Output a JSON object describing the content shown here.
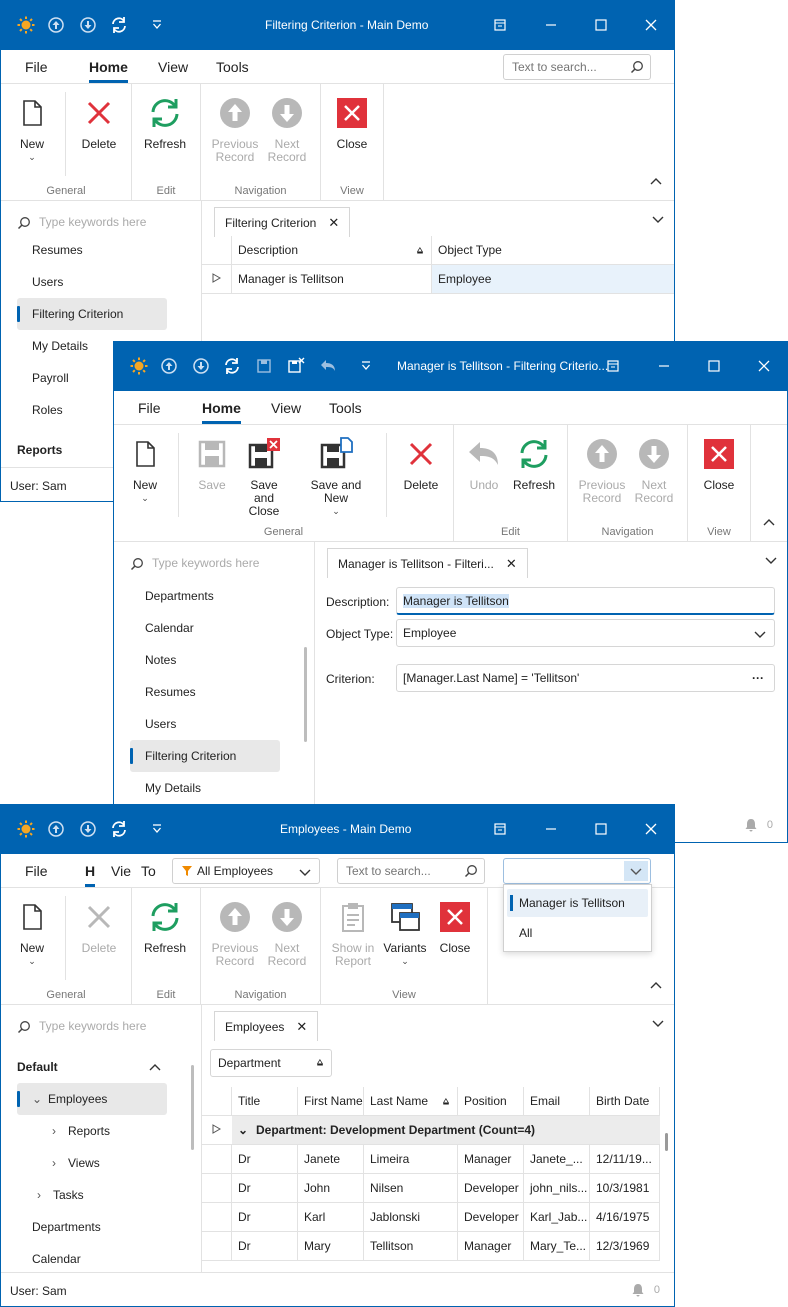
{
  "win1": {
    "title": "Filtering Criterion - Main Demo",
    "menu": {
      "file": "File",
      "home": "Home",
      "view": "View",
      "tools": "Tools"
    },
    "search_placeholder": "Text to search...",
    "ribbon": {
      "new": "New",
      "delete": "Delete",
      "refresh": "Refresh",
      "previous": "Previous Record",
      "next": "Next Record",
      "close": "Close",
      "groups": {
        "general": "General",
        "edit": "Edit",
        "navigation": "Navigation",
        "view": "View"
      }
    },
    "nav": {
      "search_placeholder": "Type keywords here",
      "items": [
        "Resumes",
        "Users",
        "Filtering Criterion",
        "My Details",
        "Payroll",
        "Roles"
      ],
      "reports": "Reports"
    },
    "tab": "Filtering Criterion",
    "grid": {
      "headers": [
        "Description",
        "Object Type"
      ],
      "rows": [
        [
          "Manager is Tellitson",
          "Employee"
        ]
      ]
    },
    "status_user": "User: Sam"
  },
  "win2": {
    "title": "Manager is Tellitson - Filtering Criterio...",
    "menu": {
      "file": "File",
      "home": "Home",
      "view": "View",
      "tools": "Tools"
    },
    "ribbon": {
      "new": "New",
      "save": "Save",
      "save_close": "Save and Close",
      "save_new": "Save and New",
      "delete": "Delete",
      "undo": "Undo",
      "refresh": "Refresh",
      "previous": "Previous Record",
      "next": "Next Record",
      "close": "Close",
      "groups": {
        "general": "General",
        "edit": "Edit",
        "navigation": "Navigation",
        "view": "View"
      }
    },
    "nav": {
      "search_placeholder": "Type keywords here",
      "items": [
        "Departments",
        "Calendar",
        "Notes",
        "Resumes",
        "Users",
        "Filtering Criterion",
        "My Details"
      ]
    },
    "tab": "Manager is Tellitson - Filteri...",
    "form": {
      "description_label": "Description:",
      "description_value": "Manager is Tellitson",
      "object_type_label": "Object Type:",
      "object_type_value": "Employee",
      "criterion_label": "Criterion:",
      "criterion_value": "[Manager.Last Name] = 'Tellitson'"
    },
    "bell_count": "0"
  },
  "win3": {
    "title": "Employees - Main Demo",
    "menu": {
      "file": "File",
      "home": "H",
      "view": "Vie",
      "tools": "To"
    },
    "filter_combo": "All Employees",
    "search_placeholder": "Text to search...",
    "dropdown_options": [
      "Manager is Tellitson",
      "All"
    ],
    "ribbon": {
      "new": "New",
      "delete": "Delete",
      "refresh": "Refresh",
      "previous": "Previous Record",
      "next": "Next Record",
      "show_report": "Show in Report",
      "variants": "Variants",
      "close": "Close",
      "groups": {
        "general": "General",
        "edit": "Edit",
        "navigation": "Navigation",
        "view": "View"
      }
    },
    "nav": {
      "search_placeholder": "Type keywords here",
      "default": "Default",
      "employees": "Employees",
      "reports": "Reports",
      "views": "Views",
      "tasks": "Tasks",
      "departments": "Departments",
      "calendar": "Calendar"
    },
    "tab": "Employees",
    "group_panel": "Department",
    "grid": {
      "headers": [
        "Title",
        "First Name",
        "Last Name",
        "Position",
        "Email",
        "Birth Date"
      ],
      "group_row": "Department: Development Department (Count=4)",
      "rows": [
        [
          "Dr",
          "Janete",
          "Limeira",
          "Manager",
          "Janete_...",
          "12/11/19..."
        ],
        [
          "Dr",
          "John",
          "Nilsen",
          "Developer",
          "john_nils...",
          "10/3/1981"
        ],
        [
          "Dr",
          "Karl",
          "Jablonski",
          "Developer",
          "Karl_Jab...",
          "4/16/1975"
        ],
        [
          "Dr",
          "Mary",
          "Tellitson",
          "Manager",
          "Mary_Te...",
          "12/3/1969"
        ]
      ]
    },
    "status_user": "User: Sam",
    "bell_count": "0"
  },
  "colors": {
    "accent": "#0063b1",
    "delete": "#e0323b",
    "refresh": "#1e9e60",
    "close_bg": "#e0323b",
    "disabled": "#b8b8b8"
  }
}
